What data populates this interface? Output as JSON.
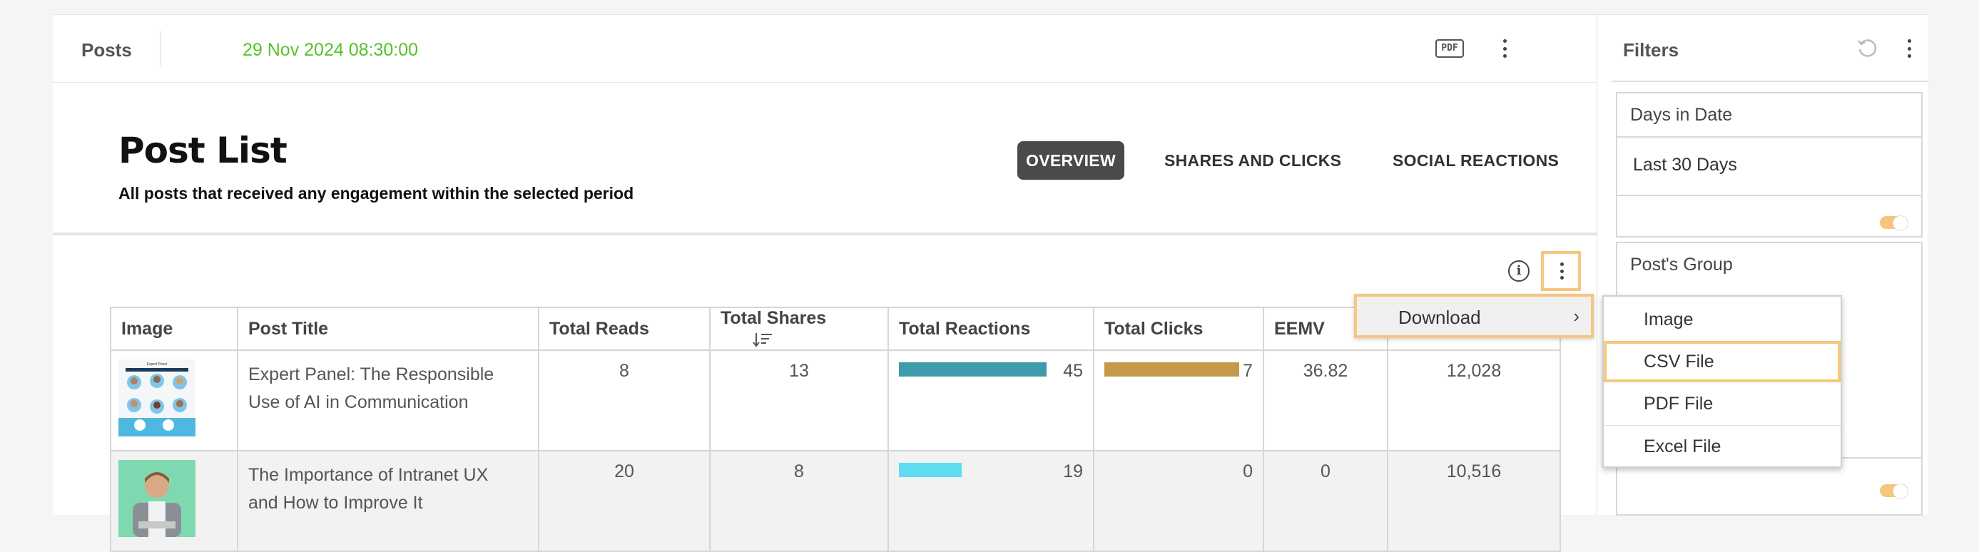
{
  "topbar": {
    "title": "Posts",
    "timestamp": "29 Nov 2024 08:30:00",
    "pdf_label": "PDF"
  },
  "header": {
    "title": "Post List",
    "subtitle": "All posts that received any engagement within the selected period",
    "tabs": [
      {
        "label": "OVERVIEW",
        "active": true
      },
      {
        "label": "SHARES AND CLICKS",
        "active": false
      },
      {
        "label": "SOCIAL REACTIONS",
        "active": false
      }
    ]
  },
  "info_icon_label": "i",
  "table": {
    "columns": [
      "Image",
      "Post Title",
      "Total Reads",
      "Total Shares",
      "Total Reactions",
      "Total Clicks",
      "EEMV",
      ""
    ],
    "rows": [
      {
        "title_line1": "Expert Panel: The Responsible",
        "title_line2": "Use of AI in Communication",
        "reads": "8",
        "shares": "13",
        "reactions": "45",
        "reactions_fraction": 0.47,
        "reactions_color": "#3d9baa",
        "clicks": "7",
        "clicks_fraction": 0.43,
        "clicks_color": "#c49a4a",
        "eemv": "36.82",
        "extra": "12,028",
        "thumb_title": "Expert Panel"
      },
      {
        "title_line1": "The Importance of Intranet UX",
        "title_line2": "and How to Improve It",
        "reads": "20",
        "shares": "8",
        "reactions": "19",
        "reactions_fraction": 0.2,
        "reactions_color": "#5ddcf2",
        "clicks": "0",
        "clicks_fraction": 0,
        "clicks_color": "#c49a4a",
        "eemv": "0",
        "extra": "10,516"
      }
    ]
  },
  "menu": {
    "download_label": "Download",
    "chevron": "›",
    "submenu": [
      "Image",
      "CSV File",
      "PDF File",
      "Excel File"
    ],
    "highlighted": "CSV File"
  },
  "filters": {
    "title": "Filters",
    "days_label": "Days in Date",
    "days_value": "Last 30 Days",
    "group_label": "Post's Group"
  }
}
